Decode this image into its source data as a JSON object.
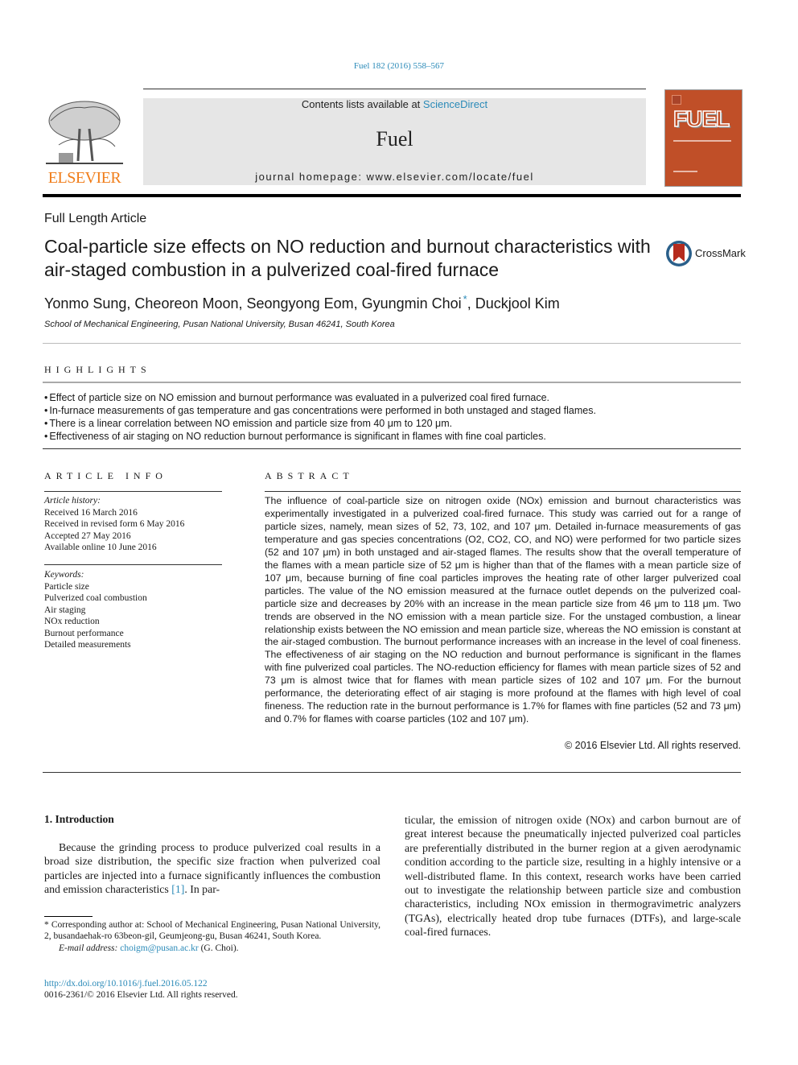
{
  "header": {
    "journal_ref": "Fuel 182 (2016) 558–567",
    "contents_prefix": "Contents lists available at ",
    "contents_link": "ScienceDirect",
    "journal_name": "Fuel",
    "homepage": "journal homepage: www.elsevier.com/locate/fuel",
    "publisher": "ELSEVIER",
    "cover_title": "FUEL",
    "publisher_color": "#f07d1a",
    "cover_color": "#c04f28"
  },
  "article": {
    "type": "Full Length Article",
    "title": "Coal-particle size effects on NO reduction and burnout characteristics with air-staged combustion in a pulverized coal-fired furnace",
    "crossmark": "CrossMark",
    "authors_before": "Yonmo Sung, Cheoreon Moon, Seongyong Eom, Gyungmin Choi",
    "author_mark": "*",
    "authors_after": ", Duckjool Kim",
    "affiliation": "School of Mechanical Engineering, Pusan National University, Busan 46241, South Korea"
  },
  "highlights": {
    "label": "HIGHLIGHTS",
    "items": [
      "Effect of particle size on NO emission and burnout performance was evaluated in a pulverized coal fired furnace.",
      "In-furnace measurements of gas temperature and gas concentrations were performed in both unstaged and staged flames.",
      "There is a linear correlation between NO emission and particle size from 40 μm to 120 μm.",
      "Effectiveness of air staging on NO reduction burnout performance is significant in flames with fine coal particles."
    ]
  },
  "article_info": {
    "label": "ARTICLE INFO",
    "history_label": "Article history:",
    "history": [
      "Received 16 March 2016",
      "Received in revised form 6 May 2016",
      "Accepted 27 May 2016",
      "Available online 10 June 2016"
    ],
    "keywords_label": "Keywords:",
    "keywords": [
      "Particle size",
      "Pulverized coal combustion",
      "Air staging",
      "NOx reduction",
      "Burnout performance",
      "Detailed measurements"
    ]
  },
  "abstract": {
    "label": "ABSTRACT",
    "text": "The influence of coal-particle size on nitrogen oxide (NOx) emission and burnout characteristics was experimentally investigated in a pulverized coal-fired furnace. This study was carried out for a range of particle sizes, namely, mean sizes of 52, 73, 102, and 107 μm. Detailed in-furnace measurements of gas temperature and gas species concentrations (O2, CO2, CO, and NO) were performed for two particle sizes (52 and 107 μm) in both unstaged and air-staged flames. The results show that the overall temperature of the flames with a mean particle size of 52 μm is higher than that of the flames with a mean particle size of 107 μm, because burning of fine coal particles improves the heating rate of other larger pulverized coal particles. The value of the NO emission measured at the furnace outlet depends on the pulverized coal-particle size and decreases by 20% with an increase in the mean particle size from 46 μm to 118 μm. Two trends are observed in the NO emission with a mean particle size. For the unstaged combustion, a linear relationship exists between the NO emission and mean particle size, whereas the NO emission is constant at the air-staged combustion. The burnout performance increases with an increase in the level of coal fineness. The effectiveness of air staging on the NO reduction and burnout performance is significant in the flames with fine pulverized coal particles. The NO-reduction efficiency for flames with mean particle sizes of 52 and 73 μm is almost twice that for flames with mean particle sizes of 102 and 107 μm. For the burnout performance, the deteriorating effect of air staging is more profound at the flames with high level of coal fineness. The reduction rate in the burnout performance is 1.7% for flames with fine particles (52 and 73 μm) and 0.7% for flames with coarse particles (102 and 107 μm).",
    "copyright": "© 2016 Elsevier Ltd. All rights reserved."
  },
  "introduction": {
    "heading": "1. Introduction",
    "p1_text": "Because the grinding process to produce pulverized coal results in a broad size distribution, the specific size fraction when pulverized coal particles are injected into a furnace significantly influences the combustion and emission characteristics ",
    "p1_ref": "[1]",
    "p1_tail": ". In par-",
    "p2": "ticular, the emission of nitrogen oxide (NOx) and carbon burnout are of great interest because the pneumatically injected pulverized coal particles are preferentially distributed in the burner region at a given aerodynamic condition according to the particle size, resulting in a highly intensive or a well-distributed flame. In this context, research works have been carried out to investigate the relationship between particle size and combustion characteristics, including NOx emission in thermogravimetric analyzers (TGAs), electrically heated drop tube furnaces (DTFs), and large-scale coal-fired furnaces."
  },
  "footnote": {
    "text": "* Corresponding author at: School of Mechanical Engineering, Pusan National University, 2, busandaehak-ro 63beon-gil, Geumjeong-gu, Busan 46241, South Korea.",
    "email_label": "E-mail address: ",
    "email": "choigm@pusan.ac.kr",
    "email_tail": " (G. Choi).",
    "doi": "http://dx.doi.org/10.1016/j.fuel.2016.05.122",
    "issn": "0016-2361/© 2016 Elsevier Ltd. All rights reserved."
  }
}
